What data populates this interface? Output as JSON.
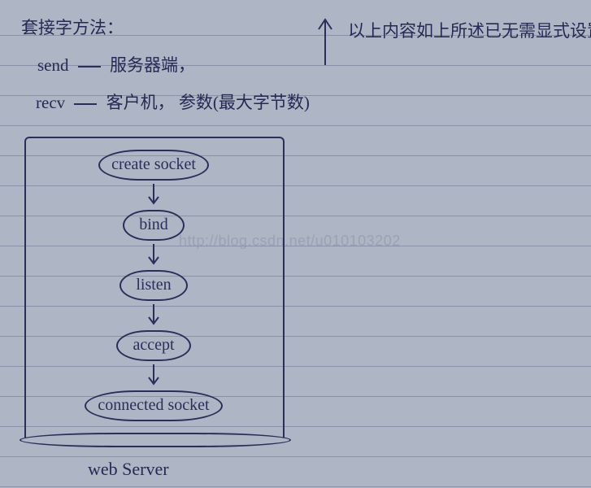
{
  "notes": {
    "heading": "套接字方法：",
    "line_send": {
      "method": "send",
      "target": "服务器端，",
      "dash": "—"
    },
    "line_recv": {
      "method": "recv",
      "target": "客户机，",
      "params": "参数(最大字节数)",
      "dash": "—"
    },
    "right_note": "以上内容如上所述已无需显式设置"
  },
  "flowchart": {
    "box_label": "web Server",
    "steps": [
      "create socket",
      "bind",
      "listen",
      "accept",
      "connected socket"
    ]
  },
  "watermark": "http://blog.csdn.net/u010103202",
  "icons": {
    "down_arrow": "down-arrow-icon",
    "up_arrow": "up-arrow-icon"
  }
}
